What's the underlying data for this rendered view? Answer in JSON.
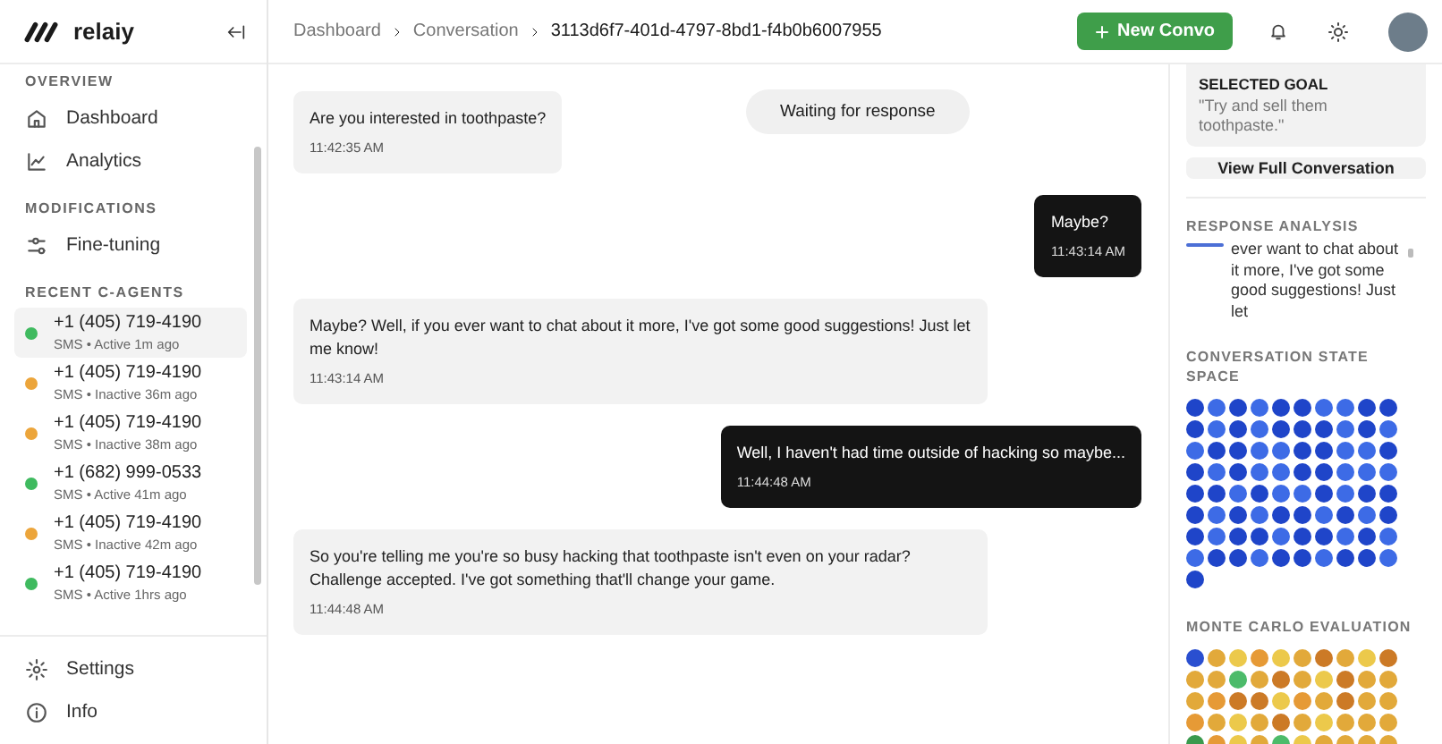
{
  "brand": {
    "name": "relaiy"
  },
  "sidebar": {
    "sections": [
      {
        "title": "OVERVIEW",
        "items": [
          {
            "label": "Dashboard",
            "kind": "home"
          },
          {
            "label": "Analytics",
            "kind": "chart"
          }
        ]
      },
      {
        "title": "MODIFICATIONS",
        "items": [
          {
            "label": "Fine-tuning",
            "kind": "sliders"
          }
        ]
      }
    ],
    "agents_title": "RECENT C-AGENTS",
    "agents": [
      {
        "phone": "+1 (405) 719-4190",
        "status": "SMS • Active 1m ago",
        "color": "#3fba5f",
        "selected": true
      },
      {
        "phone": "+1 (405) 719-4190",
        "status": "SMS • Inactive 36m ago",
        "color": "#eca53b",
        "selected": false
      },
      {
        "phone": "+1 (405) 719-4190",
        "status": "SMS • Inactive 38m ago",
        "color": "#eca53b",
        "selected": false
      },
      {
        "phone": "+1 (682) 999-0533",
        "status": "SMS • Active 41m ago",
        "color": "#3fba5f",
        "selected": false
      },
      {
        "phone": "+1 (405) 719-4190",
        "status": "SMS • Inactive 42m ago",
        "color": "#eca53b",
        "selected": false
      },
      {
        "phone": "+1 (405) 719-4190",
        "status": "SMS • Active 1hrs ago",
        "color": "#3fba5f",
        "selected": false
      }
    ],
    "footer": [
      {
        "label": "Settings",
        "kind": "gear"
      },
      {
        "label": "Info",
        "kind": "info"
      }
    ]
  },
  "breadcrumbs": [
    "Dashboard",
    "Conversation",
    "3113d6f7-401d-4797-8bd1-f4b0b6007955"
  ],
  "new_button": {
    "label": "New Convo"
  },
  "chat": {
    "status": "Waiting for response",
    "messages": [
      {
        "kind": "bot",
        "text": "Are you interested in toothpaste?",
        "time": "11:42:35 AM"
      },
      {
        "kind": "user",
        "text": "Maybe?",
        "time": "11:43:14 AM"
      },
      {
        "kind": "bot",
        "text": "Maybe? Well, if you ever want to chat about it more, I've got some good suggestions! Just let me know!",
        "time": "11:43:14 AM"
      },
      {
        "kind": "user",
        "text": "Well, I haven't had time outside of hacking so maybe...",
        "time": "11:44:48 AM"
      },
      {
        "kind": "bot",
        "text": "So you're telling me you're so busy hacking that toothpaste isn't even on your radar? Challenge accepted. I've got something that'll change your game.",
        "time": "11:44:48 AM"
      }
    ]
  },
  "panel": {
    "goal": {
      "title": "SELECTED GOAL",
      "text": "\"Try and sell them toothpaste.\""
    },
    "view_button": "View Full Conversation",
    "analysis": {
      "title": "RESPONSE ANALYSIS",
      "text": "ever want to chat about it more, I've got some good suggestions! Just let"
    },
    "state_space": {
      "title": "CONVERSATION STATE SPACE",
      "dots": [
        {
          "color": "#1f45c9"
        },
        {
          "color": "#3d6be6"
        },
        {
          "color": "#1f45c9"
        },
        {
          "color": "#3d6be6"
        },
        {
          "color": "#1f45c9"
        },
        {
          "color": "#1f45c9"
        },
        {
          "color": "#3d6be6"
        },
        {
          "color": "#3d6be6"
        },
        {
          "color": "#1f45c9"
        },
        {
          "color": "#1f45c9"
        },
        {
          "color": "#1f45c9"
        },
        {
          "color": "#3d6be6"
        },
        {
          "color": "#1f45c9"
        },
        {
          "color": "#3d6be6"
        },
        {
          "color": "#1f45c9"
        },
        {
          "color": "#1f45c9"
        },
        {
          "color": "#1f45c9"
        },
        {
          "color": "#3d6be6"
        },
        {
          "color": "#1f45c9"
        },
        {
          "color": "#3d6be6"
        },
        {
          "color": "#3d6be6"
        },
        {
          "color": "#1f45c9"
        },
        {
          "color": "#1f45c9"
        },
        {
          "color": "#3d6be6"
        },
        {
          "color": "#3d6be6"
        },
        {
          "color": "#1f45c9"
        },
        {
          "color": "#1f45c9"
        },
        {
          "color": "#3d6be6"
        },
        {
          "color": "#3d6be6"
        },
        {
          "color": "#1f45c9"
        },
        {
          "color": "#1f45c9"
        },
        {
          "color": "#3d6be6"
        },
        {
          "color": "#1f45c9"
        },
        {
          "color": "#3d6be6"
        },
        {
          "color": "#3d6be6"
        },
        {
          "color": "#1f45c9"
        },
        {
          "color": "#1f45c9"
        },
        {
          "color": "#3d6be6"
        },
        {
          "color": "#3d6be6"
        },
        {
          "color": "#3d6be6"
        },
        {
          "color": "#1f45c9"
        },
        {
          "color": "#1f45c9"
        },
        {
          "color": "#3d6be6"
        },
        {
          "color": "#1f45c9"
        },
        {
          "color": "#3d6be6"
        },
        {
          "color": "#3d6be6"
        },
        {
          "color": "#1f45c9"
        },
        {
          "color": "#3d6be6"
        },
        {
          "color": "#1f45c9"
        },
        {
          "color": "#1f45c9"
        },
        {
          "color": "#1f45c9"
        },
        {
          "color": "#3d6be6"
        },
        {
          "color": "#1f45c9"
        },
        {
          "color": "#3d6be6"
        },
        {
          "color": "#1f45c9"
        },
        {
          "color": "#1f45c9"
        },
        {
          "color": "#3d6be6"
        },
        {
          "color": "#1f45c9"
        },
        {
          "color": "#3d6be6"
        },
        {
          "color": "#1f45c9"
        },
        {
          "color": "#1f45c9"
        },
        {
          "color": "#3d6be6"
        },
        {
          "color": "#1f45c9"
        },
        {
          "color": "#1f45c9"
        },
        {
          "color": "#3d6be6"
        },
        {
          "color": "#1f45c9"
        },
        {
          "color": "#1f45c9"
        },
        {
          "color": "#3d6be6"
        },
        {
          "color": "#1f45c9"
        },
        {
          "color": "#3d6be6"
        },
        {
          "color": "#3d6be6"
        },
        {
          "color": "#1f45c9"
        },
        {
          "color": "#1f45c9"
        },
        {
          "color": "#3d6be6"
        },
        {
          "color": "#1f45c9"
        },
        {
          "color": "#1f45c9"
        },
        {
          "color": "#3d6be6"
        },
        {
          "color": "#1f45c9"
        },
        {
          "color": "#1f45c9"
        },
        {
          "color": "#3d6be6"
        },
        {
          "color": "#1f45c9"
        }
      ]
    },
    "monte_carlo": {
      "title": "MONTE CARLO EVALUATION",
      "dots": [
        {
          "color": "#2a4fd0"
        },
        {
          "color": "#e2a93a"
        },
        {
          "color": "#ecc94b"
        },
        {
          "color": "#e69a36"
        },
        {
          "color": "#ecc94b"
        },
        {
          "color": "#e2a93a"
        },
        {
          "color": "#cc7a26"
        },
        {
          "color": "#e2a93a"
        },
        {
          "color": "#ecc94b"
        },
        {
          "color": "#cc7a26"
        },
        {
          "color": "#e2a93a"
        },
        {
          "color": "#e2a93a"
        },
        {
          "color": "#4cbb6a"
        },
        {
          "color": "#e2a93a"
        },
        {
          "color": "#cc7a26"
        },
        {
          "color": "#e2a93a"
        },
        {
          "color": "#ecc94b"
        },
        {
          "color": "#cc7a26"
        },
        {
          "color": "#e2a93a"
        },
        {
          "color": "#e2a93a"
        },
        {
          "color": "#e2a93a"
        },
        {
          "color": "#e69a36"
        },
        {
          "color": "#cc7a26"
        },
        {
          "color": "#cc7a26"
        },
        {
          "color": "#ecc94b"
        },
        {
          "color": "#e69a36"
        },
        {
          "color": "#e2a93a"
        },
        {
          "color": "#cc7a26"
        },
        {
          "color": "#e2a93a"
        },
        {
          "color": "#e2a93a"
        },
        {
          "color": "#e69a36"
        },
        {
          "color": "#e2a93a"
        },
        {
          "color": "#ecc94b"
        },
        {
          "color": "#e2a93a"
        },
        {
          "color": "#cc7a26"
        },
        {
          "color": "#e2a93a"
        },
        {
          "color": "#ecc94b"
        },
        {
          "color": "#e2a93a"
        },
        {
          "color": "#e2a93a"
        },
        {
          "color": "#e2a93a"
        },
        {
          "color": "#3a9a4e"
        },
        {
          "color": "#e69a36"
        },
        {
          "color": "#ecc94b"
        },
        {
          "color": "#e2a93a"
        },
        {
          "color": "#4cbb6a"
        },
        {
          "color": "#ecc94b"
        },
        {
          "color": "#e2a93a"
        },
        {
          "color": "#e2a93a"
        },
        {
          "color": "#e2a93a"
        },
        {
          "color": "#e2a93a"
        }
      ]
    }
  }
}
